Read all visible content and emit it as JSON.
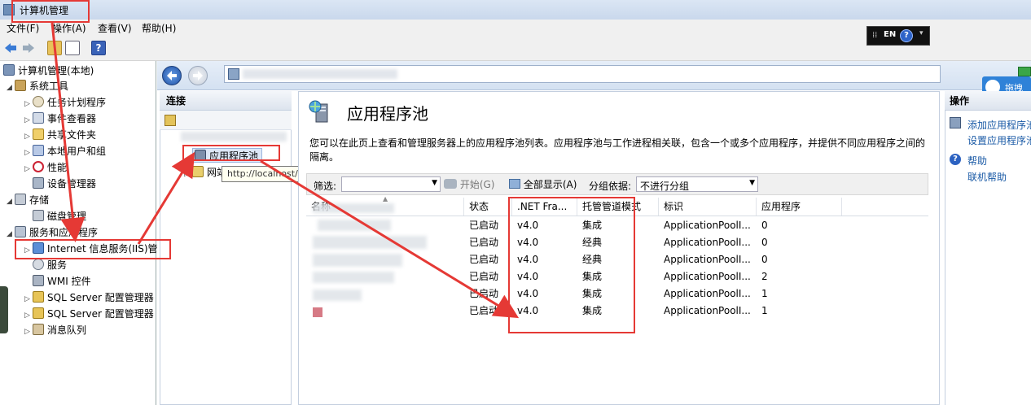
{
  "window": {
    "title": "计算机管理"
  },
  "menu": [
    "文件(F)",
    "操作(A)",
    "查看(V)",
    "帮助(H)"
  ],
  "langbar": {
    "lang": "EN",
    "help": "?"
  },
  "tree": {
    "root": "计算机管理(本地)",
    "system_tools": "系统工具",
    "task_scheduler": "任务计划程序",
    "event_viewer": "事件查看器",
    "shared_folders": "共享文件夹",
    "local_users": "本地用户和组",
    "performance": "性能",
    "device_manager": "设备管理器",
    "storage": "存储",
    "disk_mgmt": "磁盘管理",
    "services_apps": "服务和应用程序",
    "iis": "Internet 信息服务(IIS)管",
    "services": "服务",
    "wmi": "WMI 控件",
    "sql1": "SQL Server 配置管理器",
    "sql2": "SQL Server 配置管理器",
    "msmq": "消息队列"
  },
  "connections": {
    "header": "连接",
    "app_pools": "应用程序池",
    "sites": "网站",
    "tooltip": "http://localhost/"
  },
  "main": {
    "title": "应用程序池",
    "description": "您可以在此页上查看和管理服务器上的应用程序池列表。应用程序池与工作进程相关联，包含一个或多个应用程序，并提供不同应用程序之间的隔离。",
    "filter_label": "筛选:",
    "start_label": "开始(G)",
    "show_all_label": "全部显示(A)",
    "group_label": "分组依据:",
    "group_value": "不进行分组",
    "columns": [
      "名称",
      "状态",
      ".NET Fra...",
      "托管管道模式",
      "标识",
      "应用程序"
    ],
    "rows": [
      {
        "status": "已启动",
        "net": "v4.0",
        "pipeline": "集成",
        "identity": "ApplicationPoolI...",
        "apps": "0"
      },
      {
        "status": "已启动",
        "net": "v4.0",
        "pipeline": "经典",
        "identity": "ApplicationPoolI...",
        "apps": "0"
      },
      {
        "status": "已启动",
        "net": "v4.0",
        "pipeline": "经典",
        "identity": "ApplicationPoolI...",
        "apps": "0"
      },
      {
        "status": "已启动",
        "net": "v4.0",
        "pipeline": "集成",
        "identity": "ApplicationPoolI...",
        "apps": "2"
      },
      {
        "status": "已启动",
        "net": "v4.0",
        "pipeline": "集成",
        "identity": "ApplicationPoolI...",
        "apps": "1"
      },
      {
        "status": "已启动",
        "net": "v4.0",
        "pipeline": "集成",
        "identity": "ApplicationPoolI...",
        "apps": "1"
      }
    ]
  },
  "actions": {
    "header": "操作",
    "add_pool": "添加应用程序池",
    "set_defaults": "设置应用程序池",
    "help": "帮助",
    "online_help": "联机帮助",
    "badge": "拖拽"
  },
  "colors": {
    "annotation": "#e53935",
    "link": "#1a5aa6"
  }
}
